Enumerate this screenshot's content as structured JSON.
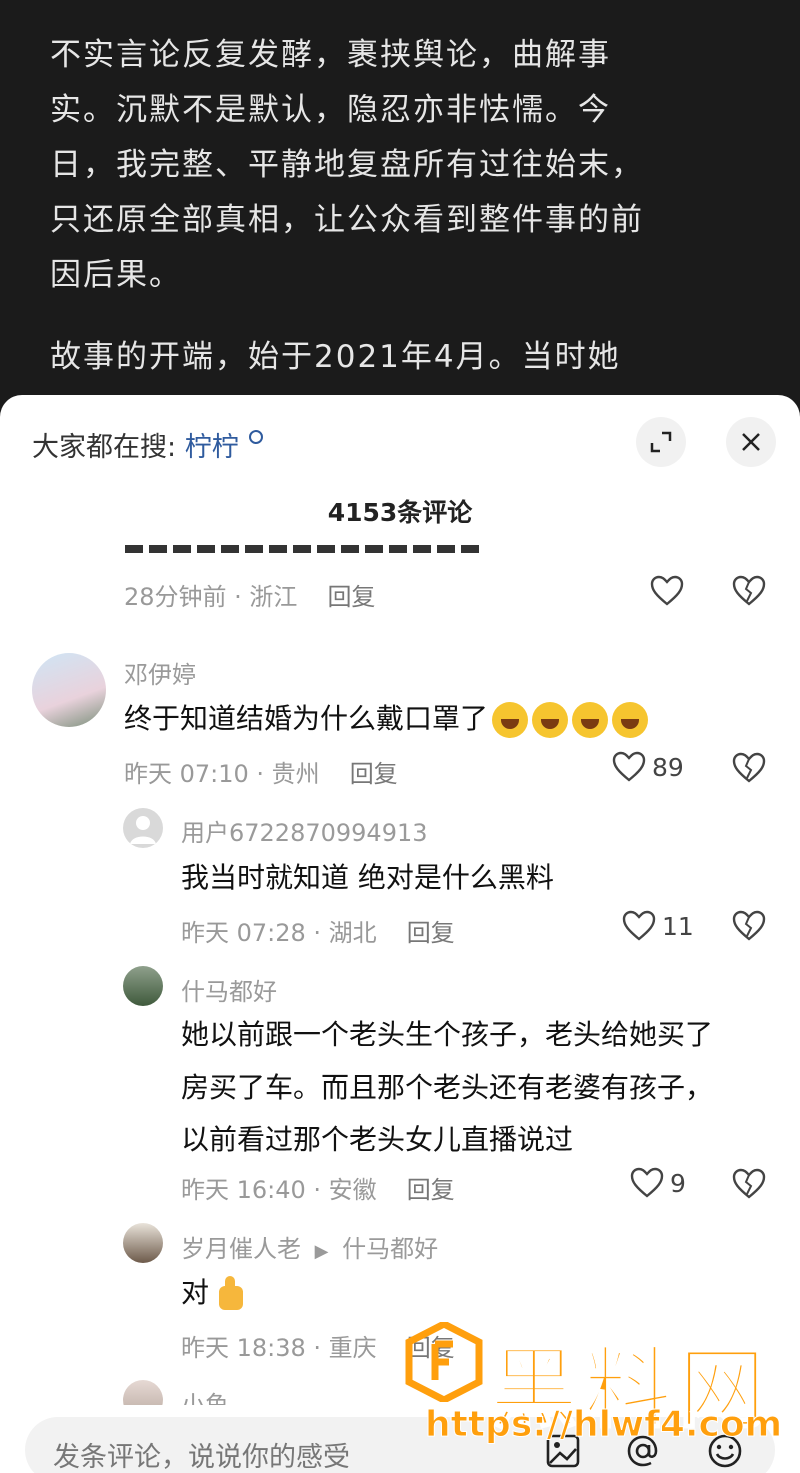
{
  "article": {
    "paragraph1": "不实言论反复发酵，裹挟舆论，曲解事实。沉默不是默认，隐忍亦非怯懦。今日，我完整、平静地复盘所有过往始末，只还原全部真相，让公众看到整件事的前因后果。",
    "paragraph2": "故事的开端，始于2021年4月。当时她"
  },
  "sheet": {
    "search_prefix": "大家都在搜:",
    "search_keyword": "柠柠",
    "comment_count": "4153条评论"
  },
  "comments": {
    "top_meta": "28分钟前 · 浙江",
    "reply_label": "回复",
    "c1": {
      "name": "邓伊婷",
      "text": "终于知道结婚为什么戴口罩了",
      "meta": "昨天 07:10 · 贵州",
      "likes": "89"
    },
    "c2": {
      "name": "用户6722870994913",
      "text": "我当时就知道  绝对是什么黑料",
      "meta": "昨天 07:28 · 湖北",
      "likes": "11"
    },
    "c3": {
      "name": "什马都好",
      "text_line1": "她以前跟一个老头生个孩子，老头给她买了",
      "text_line2": "房买了车。而且那个老头还有老婆有孩子，",
      "text_line3": "以前看过那个老头女儿直播说过",
      "meta": "昨天 16:40 · 安徽",
      "likes": "9"
    },
    "c4": {
      "name": "岁月催人老",
      "reply_to": "什马都好",
      "text": "对",
      "meta": "昨天 18:38 · 重庆"
    },
    "c5": {
      "name": "小鱼"
    }
  },
  "input": {
    "placeholder": "发条评论，说说你的感受"
  },
  "watermark": {
    "brand": "黑料网",
    "url": "https://hlwf4.com"
  },
  "colors": {
    "keyword": "#2f5b9e",
    "watermark": "#ff9f0d"
  }
}
